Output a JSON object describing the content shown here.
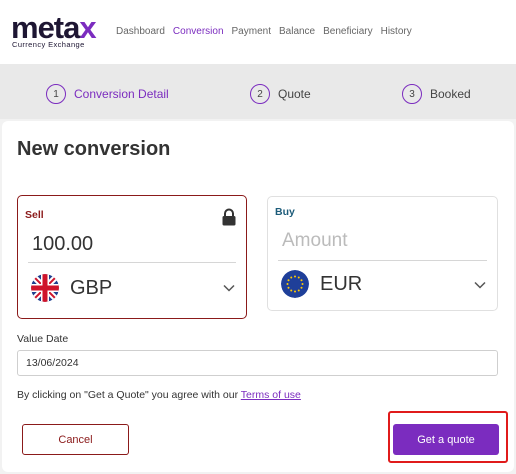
{
  "logo": {
    "word_main": "meta",
    "word_accent": "x",
    "tagline": "Currency Exchange"
  },
  "nav": [
    {
      "label": "Dashboard",
      "active": false
    },
    {
      "label": "Conversion",
      "active": true
    },
    {
      "label": "Payment",
      "active": false
    },
    {
      "label": "Balance",
      "active": false
    },
    {
      "label": "Beneficiary",
      "active": false
    },
    {
      "label": "History",
      "active": false
    }
  ],
  "steps": [
    {
      "number": "1",
      "label": "Conversion Detail",
      "active": true
    },
    {
      "number": "2",
      "label": "Quote",
      "active": false
    },
    {
      "number": "3",
      "label": "Booked",
      "active": false
    }
  ],
  "form": {
    "title": "New conversion",
    "sell": {
      "label": "Sell",
      "amount": "100.00",
      "currency": "GBP",
      "lock_icon": "lock-icon"
    },
    "buy": {
      "label": "Buy",
      "amount_placeholder": "Amount",
      "amount_value": "",
      "currency": "EUR"
    },
    "value_date": {
      "label": "Value Date",
      "value": "13/06/2024"
    },
    "terms": {
      "prefix": "By clicking on \"Get a Quote\" you agree with our ",
      "link": "Terms of use"
    },
    "cancel_label": "Cancel",
    "quote_label": "Get a quote"
  },
  "colors": {
    "accent": "#7b2cbf",
    "sell_border": "#8b1a1a",
    "buy_label": "#1d5c7a",
    "highlight": "#e01b1b"
  }
}
